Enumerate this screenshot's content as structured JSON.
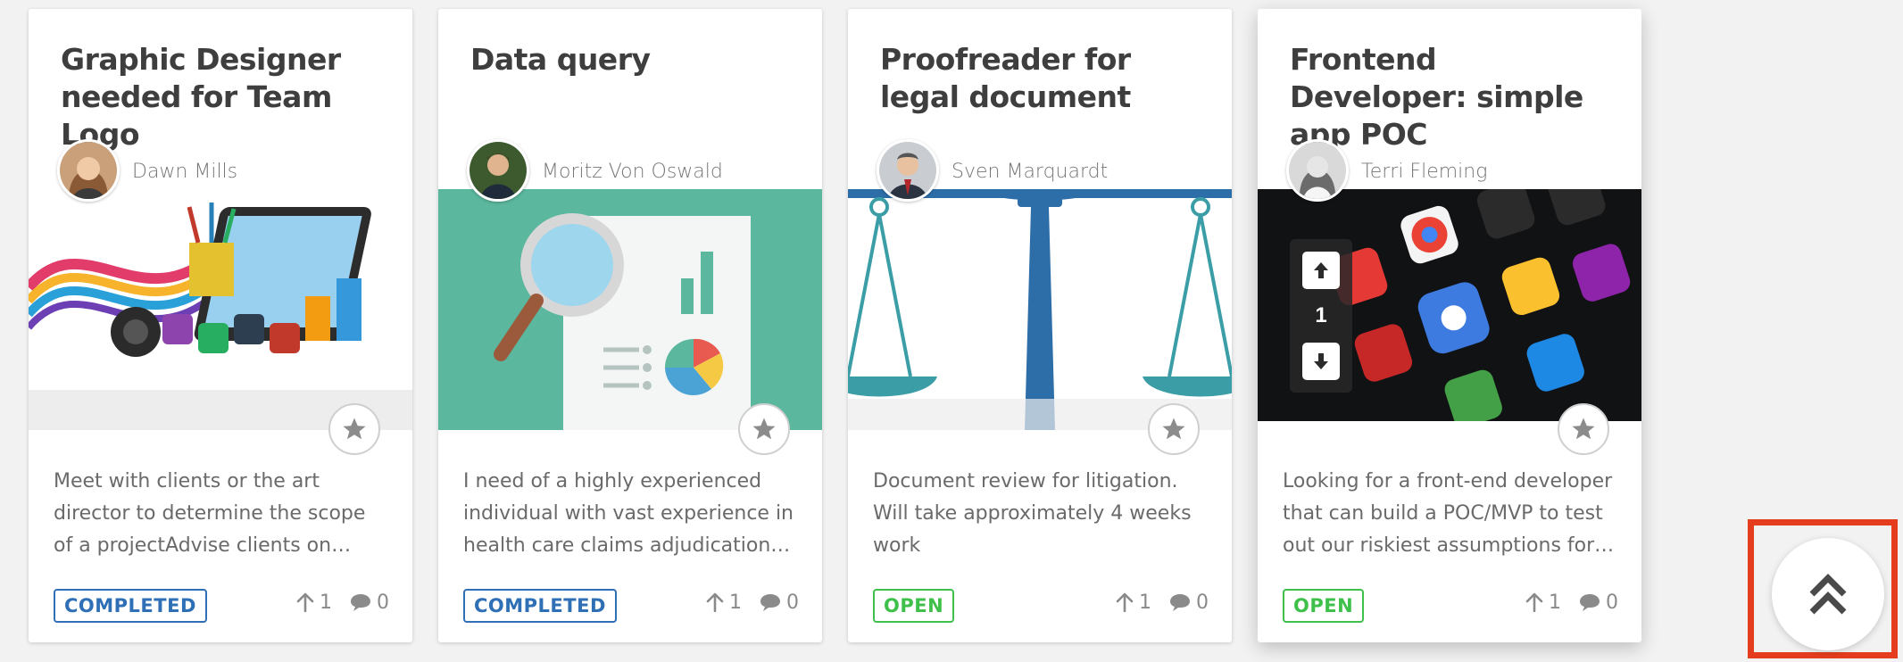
{
  "cards": [
    {
      "title": "Graphic Designer needed for Team Logo",
      "author": "Dawn Mills",
      "description": "Meet with clients or the art director to determine the scope of a projectAdvise clients on strategies t…",
      "status": "COMPLETED",
      "upvotes": "1",
      "comments": "0"
    },
    {
      "title": "Data query",
      "author": "Moritz Von Oswald",
      "description": "I need of a highly experienced individual with vast experience in health care claims adjudication and…",
      "status": "COMPLETED",
      "upvotes": "1",
      "comments": "0"
    },
    {
      "title": "Proofreader for legal document",
      "author": "Sven Marquardt",
      "description": "Document review for litigation. Will take approximately 4 weeks work",
      "status": "OPEN",
      "upvotes": "1",
      "comments": "0"
    },
    {
      "title": "Frontend Developer: simple app POC",
      "author": "Terri Fleming",
      "description": "Looking for a front-end developer that can build a POC/MVP to test out our riskiest assumptions for our ne…",
      "status": "OPEN",
      "upvotes": "1",
      "comments": "0",
      "vote_widget_count": "1"
    }
  ],
  "icons": {
    "star": "star-icon",
    "upvote": "arrow-up-icon",
    "comment": "comment-bubble-icon",
    "scroll_top": "double-chevron-up-icon"
  },
  "colors": {
    "completed": "#2e6fb5",
    "open": "#3ec04a",
    "highlight": "#e43d1e"
  }
}
